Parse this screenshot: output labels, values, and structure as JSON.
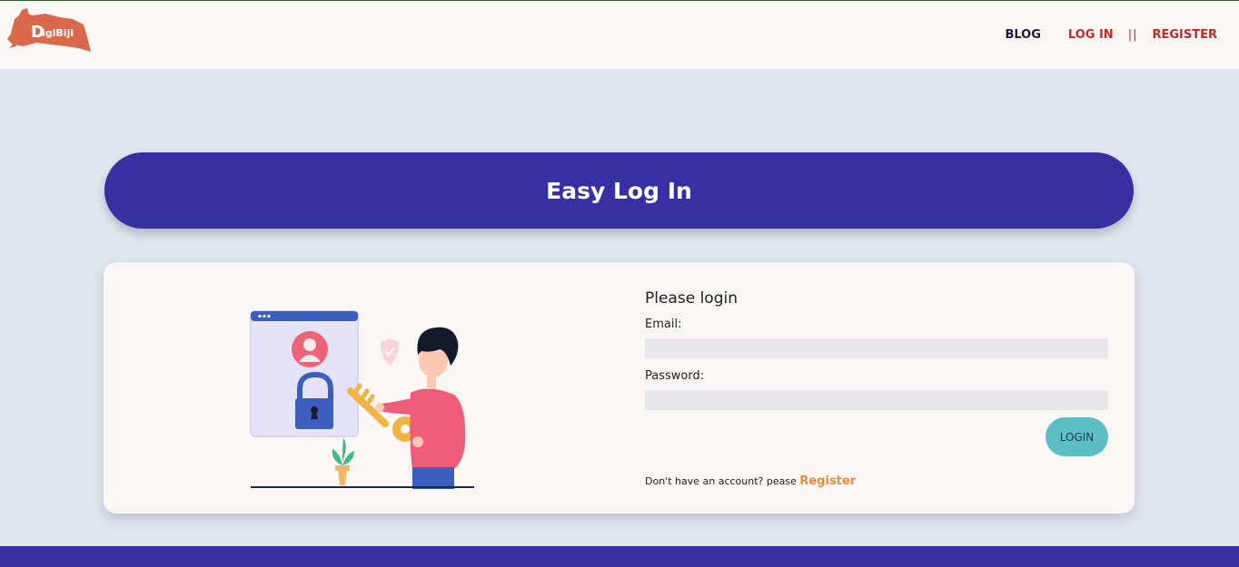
{
  "brand": {
    "logo_text": "DigiBiji",
    "logo_color": "#d9694a"
  },
  "nav": {
    "blog": "BLOG",
    "login": "LOG IN",
    "separator": "||",
    "register": "REGISTER"
  },
  "hero": {
    "title": "Easy Log In"
  },
  "login_form": {
    "title": "Please login",
    "email_label": "Email:",
    "email_value": "",
    "password_label": "Password:",
    "password_value": "",
    "submit_label": "LOGIN",
    "register_prompt": "Don't have an account? pease",
    "register_link": "Register"
  },
  "colors": {
    "primary": "#3730a3",
    "accent_red": "#c2282a",
    "accent_orange": "#e9893a",
    "button_teal": "#5bbfc5",
    "page_bg": "#e0e7f0",
    "surface": "#fbf7f4"
  },
  "icons": [
    "digibiji-logo",
    "login-illustration"
  ]
}
